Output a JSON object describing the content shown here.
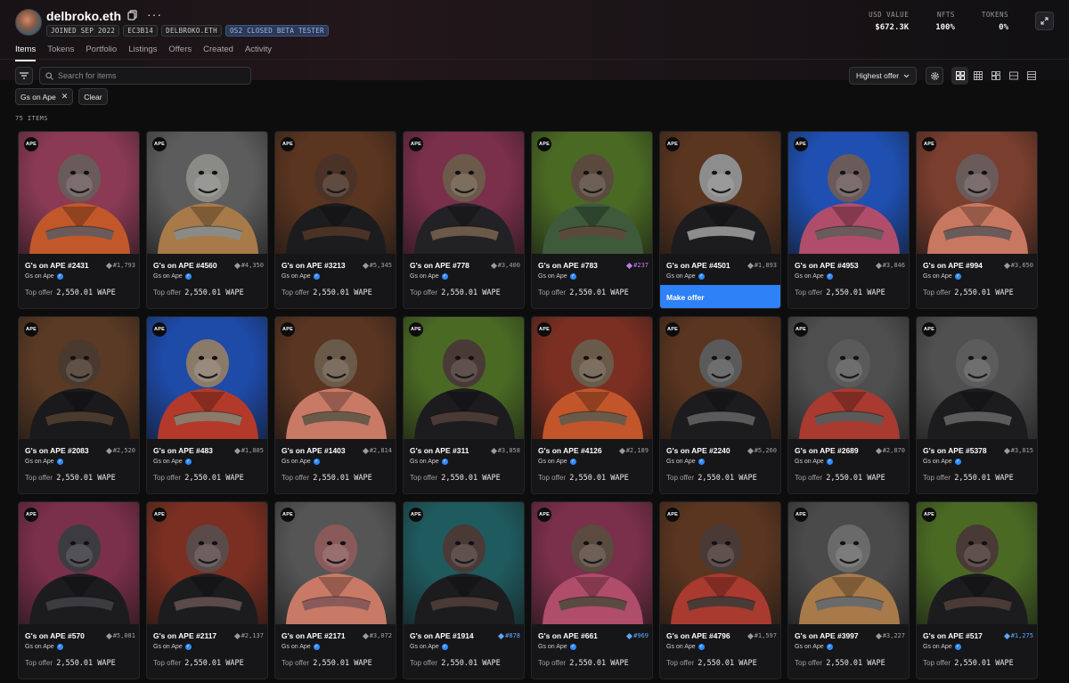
{
  "profile": {
    "username": "delbroko.eth",
    "badges": [
      "JOINED SEP 2022",
      "EC3B14",
      "DELBROKO.ETH",
      "OS2 CLOSED BETA TESTER"
    ]
  },
  "stats": [
    {
      "label": "USD VALUE",
      "value": "$672.3K"
    },
    {
      "label": "NFTS",
      "value": "100%"
    },
    {
      "label": "TOKENS",
      "value": "0%"
    }
  ],
  "tabs": [
    "Items",
    "Tokens",
    "Portfolio",
    "Listings",
    "Offers",
    "Created",
    "Activity"
  ],
  "search": {
    "placeholder": "Search for items"
  },
  "sort": {
    "label": "Highest offer"
  },
  "chips": {
    "filter": "Gs on Ape",
    "clear": "Clear"
  },
  "item_count": "75 ITEMS",
  "card_common": {
    "collection": "Gs on Ape",
    "offer_label": "Top offer",
    "offer_value": "2,550.01 WAPE",
    "badge": "APE",
    "make_offer": "Make offer"
  },
  "items": [
    {
      "name": "G's on APE #2431",
      "rank": "#1,793",
      "tier": "gray",
      "bg": "#8a3a55",
      "fur": "#6a5a5a",
      "cloth": "#c2582a",
      "hovered": false
    },
    {
      "name": "G's on APE #4560",
      "rank": "#4,350",
      "tier": "gray",
      "bg": "#5c5c5c",
      "fur": "#8a8a86",
      "cloth": "#a87a4a",
      "hovered": false
    },
    {
      "name": "G's on APE #3213",
      "rank": "#5,345",
      "tier": "gray",
      "bg": "#5a3520",
      "fur": "#4a3326",
      "cloth": "#1c1c1f",
      "hovered": false
    },
    {
      "name": "G's on APE #778",
      "rank": "#3,400",
      "tier": "gray",
      "bg": "#7a2f4a",
      "fur": "#6b5a4a",
      "cloth": "#222226",
      "hovered": false
    },
    {
      "name": "G's on APE #783",
      "rank": "#237",
      "tier": "purple",
      "bg": "#4a6a24",
      "fur": "#5a4a3e",
      "cloth": "#3e5a3a",
      "hovered": false
    },
    {
      "name": "G's on APE #4501",
      "rank": "#1,893",
      "tier": "gray",
      "bg": "#5a3520",
      "fur": "#8d8d8d",
      "cloth": "#1c1c1f",
      "hovered": true
    },
    {
      "name": "G's on APE #4953",
      "rank": "#3,846",
      "tier": "gray",
      "bg": "#1f4fb0",
      "fur": "#6a5a5a",
      "cloth": "#b04d6a",
      "hovered": false
    },
    {
      "name": "G's on APE #994",
      "rank": "#3,650",
      "tier": "gray",
      "bg": "#7a3e2e",
      "fur": "#6a5a5a",
      "cloth": "#c87860",
      "hovered": false
    },
    {
      "name": "G's on APE #2083",
      "rank": "#2,520",
      "tier": "gray",
      "bg": "#5a3a24",
      "fur": "#4a3a2e",
      "cloth": "#1a1a1c",
      "hovered": false
    },
    {
      "name": "G's on APE #483",
      "rank": "#1,805",
      "tier": "gray",
      "bg": "#1e4aa8",
      "fur": "#8a7a6a",
      "cloth": "#b33a2a",
      "hovered": false
    },
    {
      "name": "G's on APE #1403",
      "rank": "#2,814",
      "tier": "gray",
      "bg": "#5a3522",
      "fur": "#6a5a4a",
      "cloth": "#c87a66",
      "hovered": false
    },
    {
      "name": "G's on APE #311",
      "rank": "#3,858",
      "tier": "gray",
      "bg": "#4a6a24",
      "fur": "#4a3a36",
      "cloth": "#1c1c1f",
      "hovered": false
    },
    {
      "name": "G's on APE #4126",
      "rank": "#2,189",
      "tier": "gray",
      "bg": "#7a2f22",
      "fur": "#6a5a4a",
      "cloth": "#c2562a",
      "hovered": false
    },
    {
      "name": "G's on APE #2240",
      "rank": "#5,260",
      "tier": "gray",
      "bg": "#5a3520",
      "fur": "#5a5a5a",
      "cloth": "#1c1c1f",
      "hovered": false
    },
    {
      "name": "G's on APE #2689",
      "rank": "#2,870",
      "tier": "gray",
      "bg": "#4e4e4e",
      "fur": "#5a5a5a",
      "cloth": "#a83a30",
      "hovered": false
    },
    {
      "name": "G's on APE #5378",
      "rank": "#3,815",
      "tier": "gray",
      "bg": "#505050",
      "fur": "#5c5c5c",
      "cloth": "#1c1c1f",
      "hovered": false
    },
    {
      "name": "G's on APE #570",
      "rank": "#5,081",
      "tier": "gray",
      "bg": "#7a2f4a",
      "fur": "#3c3c40",
      "cloth": "#1c1c1f",
      "hovered": false
    },
    {
      "name": "G's on APE #2117",
      "rank": "#2,137",
      "tier": "gray",
      "bg": "#7a2f22",
      "fur": "#5a4a4a",
      "cloth": "#1c1c1f",
      "hovered": false
    },
    {
      "name": "G's on APE #2171",
      "rank": "#3,072",
      "tier": "gray",
      "bg": "#555555",
      "fur": "#8a5a5a",
      "cloth": "#c87a66",
      "hovered": false
    },
    {
      "name": "G's on APE #1914",
      "rank": "#878",
      "tier": "blue",
      "bg": "#1f5a5e",
      "fur": "#4a3a36",
      "cloth": "#1c1c1f",
      "hovered": false
    },
    {
      "name": "G's on APE #661",
      "rank": "#969",
      "tier": "blue",
      "bg": "#7a2f4a",
      "fur": "#5a4a40",
      "cloth": "#b04d6a",
      "hovered": false
    },
    {
      "name": "G's on APE #4796",
      "rank": "#1,597",
      "tier": "gray",
      "bg": "#5a3520",
      "fur": "#4a3a36",
      "cloth": "#a83a30",
      "hovered": false
    },
    {
      "name": "G's on APE #3997",
      "rank": "#3,227",
      "tier": "gray",
      "bg": "#4a4a4a",
      "fur": "#6a6a6a",
      "cloth": "#a87a4a",
      "hovered": false
    },
    {
      "name": "G's on APE #517",
      "rank": "#1,275",
      "tier": "blue",
      "bg": "#4a6a24",
      "fur": "#4a3a36",
      "cloth": "#1c1c1f",
      "hovered": false
    }
  ],
  "icons": {
    "copy": "copy-icon",
    "more": "more-icon",
    "expand": "expand-icon",
    "filter": "filter-icon",
    "search": "search-icon",
    "chevron": "chevron-down-icon",
    "settings": "gear-icon",
    "close": "close-icon",
    "rank": "diamond-icon",
    "verified": "verified-icon"
  },
  "colors": {
    "accent": "#2f81f7",
    "verified": "#2f8cff",
    "rare_purple": "#c27bf5",
    "rare_blue": "#5ea6ff"
  }
}
